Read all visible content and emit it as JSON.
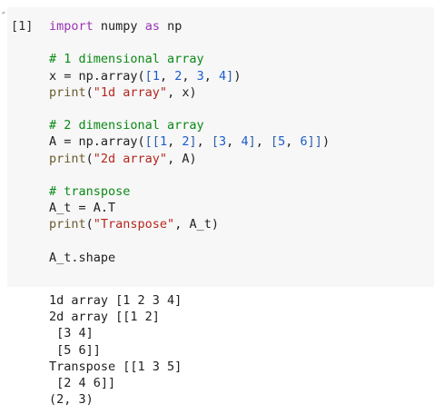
{
  "cell": {
    "prompt": "[1]",
    "gutter_marks": "≠",
    "lines": [
      {
        "type": "code",
        "tokens": [
          {
            "t": "import",
            "c": "kw"
          },
          {
            "t": " numpy ",
            "c": ""
          },
          {
            "t": "as",
            "c": "kw"
          },
          {
            "t": " np",
            "c": ""
          }
        ]
      },
      {
        "type": "blank"
      },
      {
        "type": "code",
        "tokens": [
          {
            "t": "# 1 dimensional array",
            "c": "cm"
          }
        ]
      },
      {
        "type": "code",
        "tokens": [
          {
            "t": "x = np.array(",
            "c": ""
          },
          {
            "t": "[",
            "c": "br"
          },
          {
            "t": "1",
            "c": "nu"
          },
          {
            "t": ", ",
            "c": ""
          },
          {
            "t": "2",
            "c": "nu"
          },
          {
            "t": ", ",
            "c": ""
          },
          {
            "t": "3",
            "c": "nu"
          },
          {
            "t": ", ",
            "c": ""
          },
          {
            "t": "4",
            "c": "nu"
          },
          {
            "t": "]",
            "c": "br"
          },
          {
            "t": ")",
            "c": ""
          }
        ]
      },
      {
        "type": "code",
        "tokens": [
          {
            "t": "print",
            "c": "fn"
          },
          {
            "t": "(",
            "c": ""
          },
          {
            "t": "\"1d array\"",
            "c": "st"
          },
          {
            "t": ", x)",
            "c": ""
          }
        ]
      },
      {
        "type": "blank"
      },
      {
        "type": "code",
        "tokens": [
          {
            "t": "# 2 dimensional array",
            "c": "cm"
          }
        ]
      },
      {
        "type": "code",
        "tokens": [
          {
            "t": "A = np.array(",
            "c": ""
          },
          {
            "t": "[[",
            "c": "br"
          },
          {
            "t": "1",
            "c": "nu"
          },
          {
            "t": ", ",
            "c": ""
          },
          {
            "t": "2",
            "c": "nu"
          },
          {
            "t": "]",
            "c": "br"
          },
          {
            "t": ", ",
            "c": ""
          },
          {
            "t": "[",
            "c": "br"
          },
          {
            "t": "3",
            "c": "nu"
          },
          {
            "t": ", ",
            "c": ""
          },
          {
            "t": "4",
            "c": "nu"
          },
          {
            "t": "]",
            "c": "br"
          },
          {
            "t": ", ",
            "c": ""
          },
          {
            "t": "[",
            "c": "br"
          },
          {
            "t": "5",
            "c": "nu"
          },
          {
            "t": ", ",
            "c": ""
          },
          {
            "t": "6",
            "c": "nu"
          },
          {
            "t": "]]",
            "c": "br"
          },
          {
            "t": ")",
            "c": ""
          }
        ]
      },
      {
        "type": "code",
        "tokens": [
          {
            "t": "print",
            "c": "fn"
          },
          {
            "t": "(",
            "c": ""
          },
          {
            "t": "\"2d array\"",
            "c": "st"
          },
          {
            "t": ", A)",
            "c": ""
          }
        ]
      },
      {
        "type": "blank"
      },
      {
        "type": "code",
        "tokens": [
          {
            "t": "# transpose",
            "c": "cm"
          }
        ]
      },
      {
        "type": "code",
        "tokens": [
          {
            "t": "A_t = A.T",
            "c": ""
          }
        ]
      },
      {
        "type": "code",
        "tokens": [
          {
            "t": "print",
            "c": "fn"
          },
          {
            "t": "(",
            "c": ""
          },
          {
            "t": "\"Transpose\"",
            "c": "st"
          },
          {
            "t": ", A_t)",
            "c": ""
          }
        ]
      },
      {
        "type": "blank"
      },
      {
        "type": "code",
        "tokens": [
          {
            "t": "A_t.shape",
            "c": ""
          }
        ]
      }
    ]
  },
  "output": {
    "lines": [
      "1d array [1 2 3 4]",
      "2d array [[1 2]",
      " [3 4]",
      " [5 6]]",
      "Transpose [[1 3 5]",
      " [2 4 6]]",
      "(2, 3)"
    ]
  }
}
